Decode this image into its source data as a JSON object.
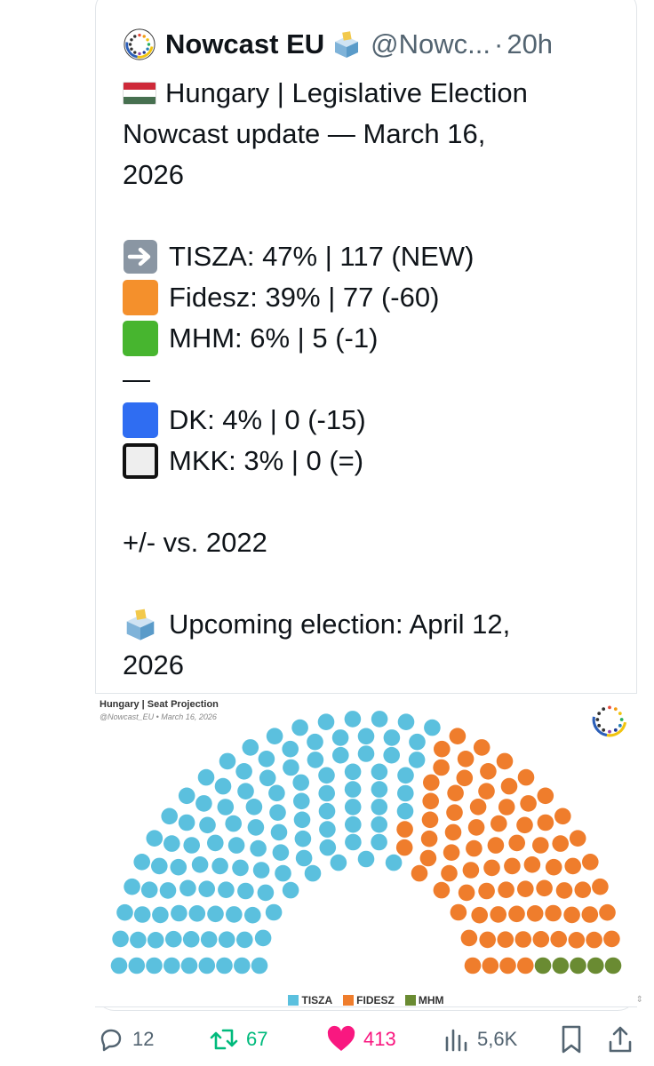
{
  "tweet": {
    "author_name": "Nowcast EU",
    "handle": "@Nowc...",
    "separator": "·",
    "time": "20h",
    "lines": [
      {
        "emoji": "flag-hungary-icon",
        "text": "Hungary | Legislative Election"
      },
      {
        "emoji": "",
        "text": "Nowcast update — March 16,"
      },
      {
        "emoji": "",
        "text": "2026"
      },
      {
        "emoji": "blank",
        "text": ""
      },
      {
        "emoji": "arrow-right-icon",
        "text": "TISZA: 47% | 117 (NEW)"
      },
      {
        "emoji": "orange-square-icon",
        "text": "Fidesz: 39% | 77 (-60)"
      },
      {
        "emoji": "green-square-icon",
        "text": "MHM: 6% | 5 (-1)"
      },
      {
        "emoji": "",
        "text": "—"
      },
      {
        "emoji": "blue-square-icon",
        "text": "DK: 4% | 0 (-15)"
      },
      {
        "emoji": "white-square-icon",
        "text": "MKK: 3% | 0 (=)"
      },
      {
        "emoji": "blank",
        "text": ""
      },
      {
        "emoji": "",
        "text": "+/- vs. 2022"
      },
      {
        "emoji": "blank",
        "text": ""
      },
      {
        "emoji": "ballot-box-icon",
        "text": "Upcoming election: April 12,"
      },
      {
        "emoji": "",
        "text": "2026"
      }
    ]
  },
  "colors": {
    "tisza": "#5bc0de",
    "fidesz": "#ef7d2c",
    "mhm": "#6a8b32",
    "muted": "#536471",
    "like": "#f91880"
  },
  "chart": {
    "title": "Hungary | Seat Projection",
    "subtitle": "@Nowcast_EU • March 16, 2026"
  },
  "chart_data": {
    "type": "parliament",
    "title": "Hungary | Seat Projection",
    "subtitle": "@Nowcast_EU • March 16, 2026",
    "series": [
      {
        "name": "TISZA",
        "value": 117,
        "color": "#5bc0de"
      },
      {
        "name": "FIDESZ",
        "value": 77,
        "color": "#ef7d2c"
      },
      {
        "name": "MHM",
        "value": 5,
        "color": "#6a8b32"
      }
    ],
    "legend_position": "bottom-center"
  },
  "actions": {
    "replies": "12",
    "reposts": "67",
    "likes": "413",
    "views": "5,6K"
  }
}
